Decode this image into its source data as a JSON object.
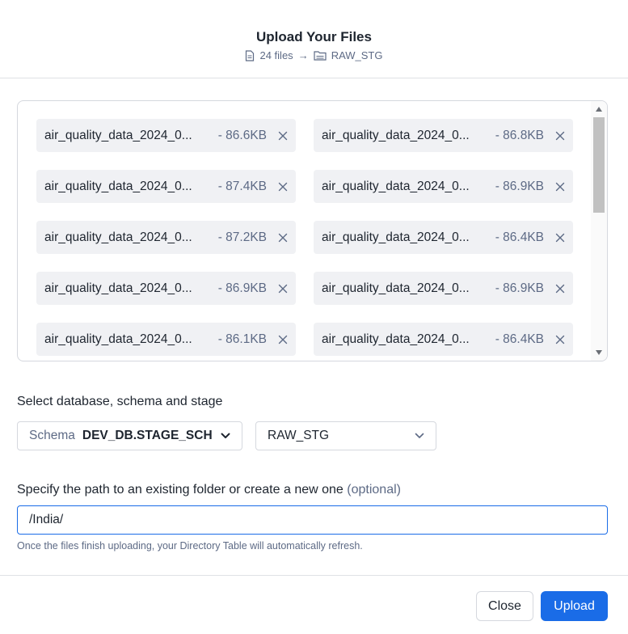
{
  "dialog": {
    "title": "Upload Your Files",
    "file_count": "24 files",
    "arrow": "→",
    "destination": "RAW_STG"
  },
  "files": [
    {
      "name": "air_quality_data_2024_0...",
      "size": "- 86.6KB"
    },
    {
      "name": "air_quality_data_2024_0...",
      "size": "- 86.8KB"
    },
    {
      "name": "air_quality_data_2024_0...",
      "size": "- 87.4KB"
    },
    {
      "name": "air_quality_data_2024_0...",
      "size": "- 86.9KB"
    },
    {
      "name": "air_quality_data_2024_0...",
      "size": "- 87.2KB"
    },
    {
      "name": "air_quality_data_2024_0...",
      "size": "- 86.4KB"
    },
    {
      "name": "air_quality_data_2024_0...",
      "size": "- 86.9KB"
    },
    {
      "name": "air_quality_data_2024_0...",
      "size": "- 86.9KB"
    },
    {
      "name": "air_quality_data_2024_0...",
      "size": "- 86.1KB"
    },
    {
      "name": "air_quality_data_2024_0...",
      "size": "- 86.4KB"
    }
  ],
  "location": {
    "label": "Select database, schema and stage",
    "schema_prefix": "Schema",
    "schema_value": "DEV_DB.STAGE_SCH",
    "stage_value": "RAW_STG"
  },
  "path": {
    "label": "Specify the path to an existing folder or create a new one",
    "optional": "(optional)",
    "value": "/India/",
    "hint": "Once the files finish uploading, your Directory Table will automatically refresh."
  },
  "footer": {
    "close_label": "Close",
    "upload_label": "Upload"
  },
  "colors": {
    "accent": "#1a6ce7",
    "chip_bg": "#f0f1f4",
    "muted_text": "#5d6a85"
  }
}
